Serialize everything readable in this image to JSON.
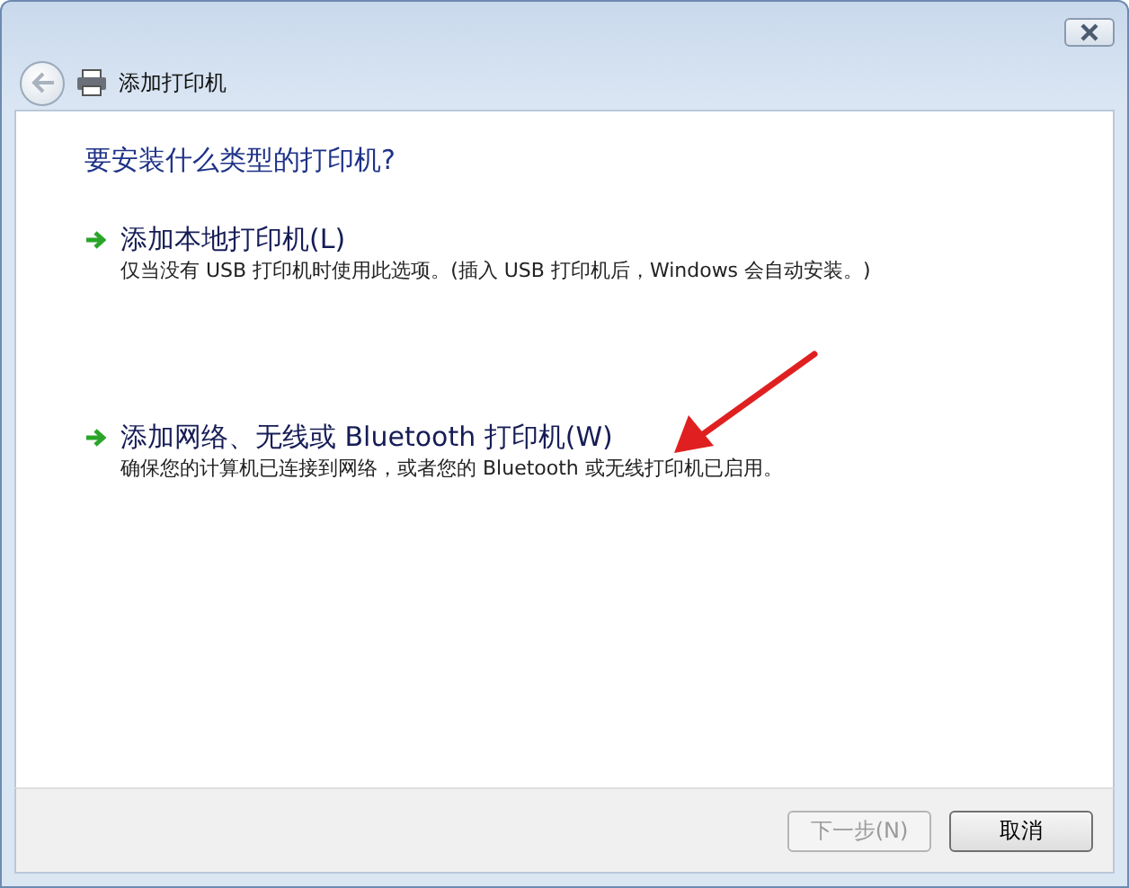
{
  "window": {
    "title": "添加打印机"
  },
  "heading": "要安装什么类型的打印机?",
  "options": [
    {
      "title": "添加本地打印机(L)",
      "description": "仅当没有 USB 打印机时使用此选项。(插入 USB 打印机后，Windows 会自动安装。)"
    },
    {
      "title": "添加网络、无线或 Bluetooth 打印机(W)",
      "description": "确保您的计算机已连接到网络，或者您的 Bluetooth 或无线打印机已启用。"
    }
  ],
  "buttons": [
    {
      "label": "下一步(N)",
      "disabled": true
    },
    {
      "label": "取消",
      "disabled": false
    }
  ]
}
